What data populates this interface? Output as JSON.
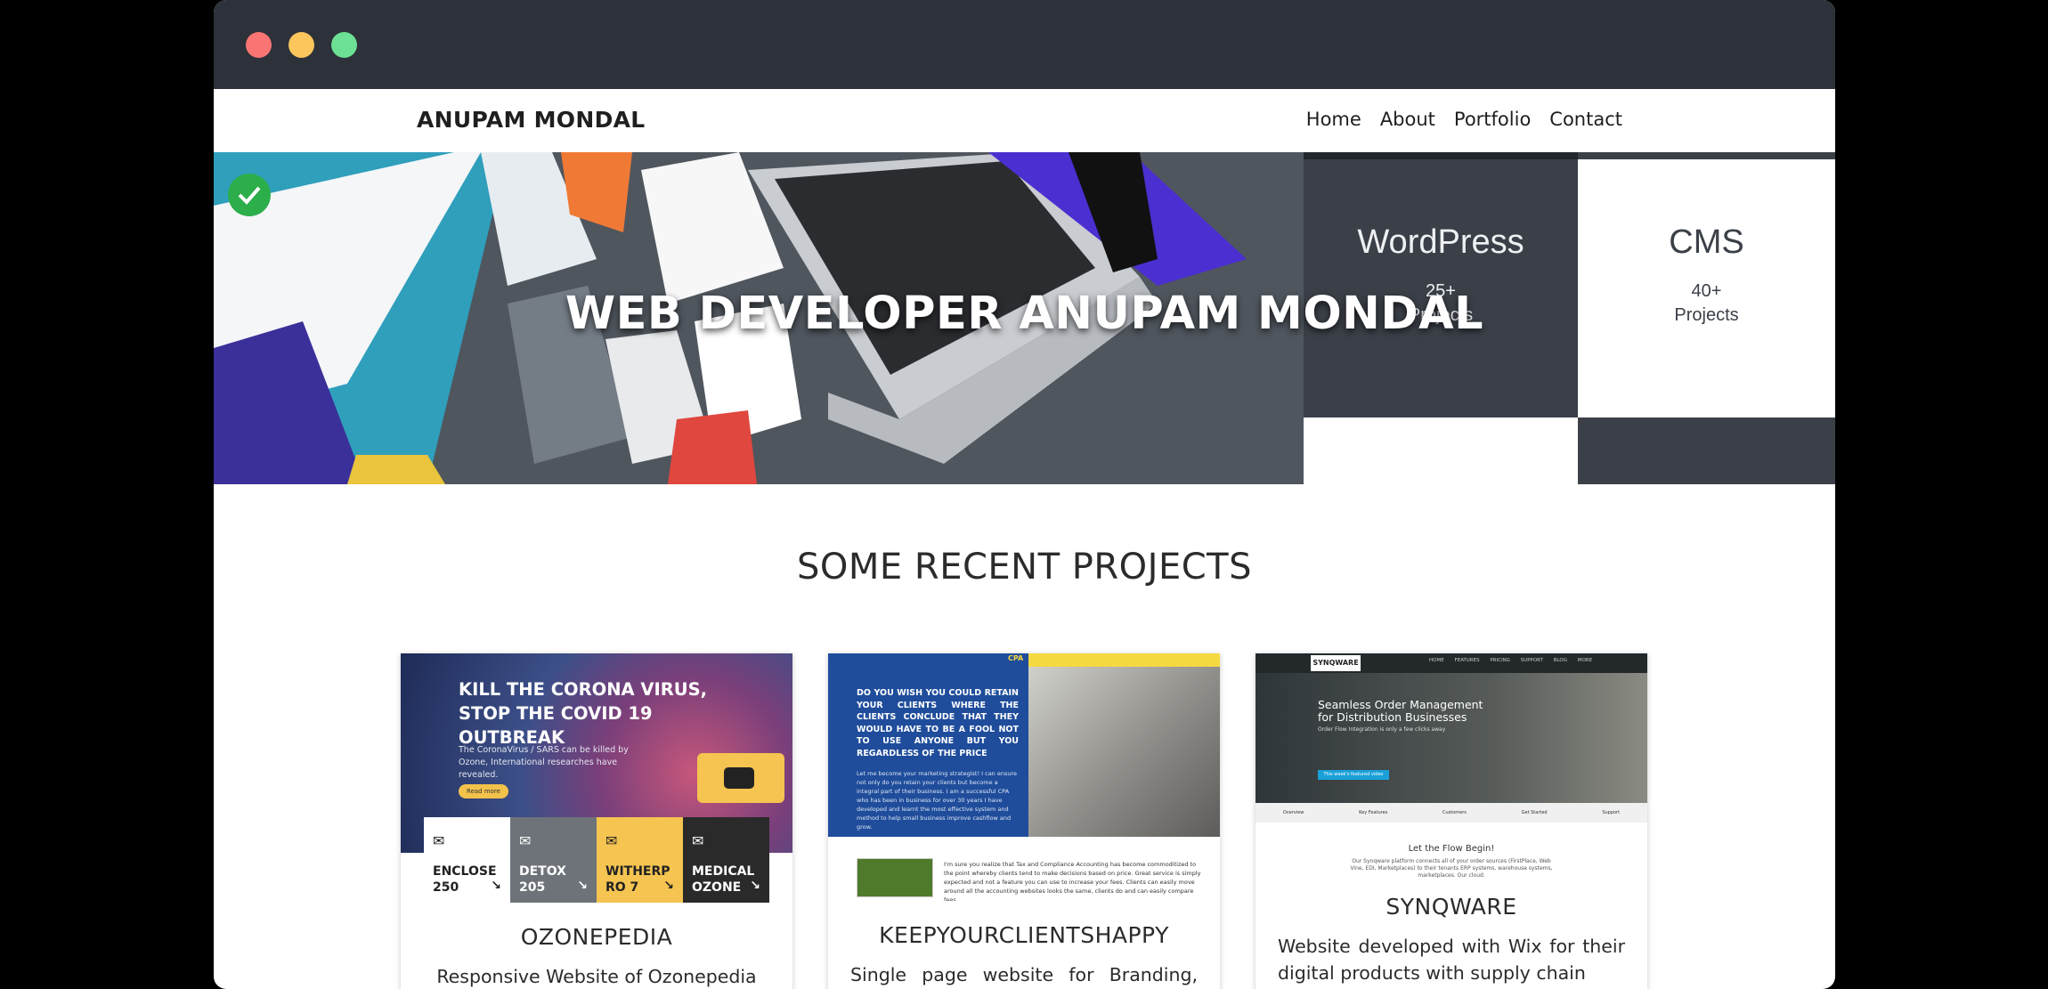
{
  "window": {
    "controls": [
      "close",
      "minimize",
      "maximize"
    ]
  },
  "navbar": {
    "brand": "ANUPAM MONDAL",
    "links": [
      "Home",
      "About",
      "Portfolio",
      "Contact"
    ]
  },
  "hero": {
    "title": "WEB DEVELOPER ANUPAM MONDAL",
    "tiles": [
      {
        "title": "WordPress",
        "count": "25+",
        "unit": "Projects"
      },
      {
        "title": "CMS",
        "count": "40+",
        "unit": "Projects"
      }
    ]
  },
  "projects": {
    "heading": "SOME RECENT PROJECTS",
    "cards": [
      {
        "title": "OZONEPEDIA",
        "desc": "Responsive Website of Ozonepedia with",
        "thumb": {
          "headline": "KILL THE CORONA VIRUS, STOP THE COVID 19 OUTBREAK",
          "sub": "The CoronaVirus / SARS can be killed by Ozone, International researches have revealed.",
          "button": "Read more",
          "tiles": [
            {
              "label": "ENCLOSE 250",
              "bg": "#ffffff",
              "fg": "#222222"
            },
            {
              "label": "DETOX 205",
              "bg": "#6e737a",
              "fg": "#ffffff"
            },
            {
              "label": "WITHERPRO 7",
              "bg": "#f5c451",
              "fg": "#222222"
            },
            {
              "label": "MEDICAL OZONE",
              "bg": "#2a2a2a",
              "fg": "#ffffff"
            }
          ]
        }
      },
      {
        "title": "KEEPYOURCLIENTSHAPPY",
        "desc": "Single page website for Branding,",
        "thumb": {
          "badge": "CPA",
          "headline": "DO YOU WISH YOU COULD RETAIN YOUR CLIENTS WHERE THE CLIENTS CONCLUDE THAT THEY WOULD HAVE TO BE A FOOL NOT TO USE ANYONE BUT YOU REGARDLESS OF THE PRICE",
          "body": "Let me become your marketing strategist! I can ensure not only do you retain your clients but become a integral part of their business. I am a successful CPA who has been in business for over 30 years I have developed and learnt the most effective system and method to help small business improve cashflow and grow.",
          "body2": "I'm sure you realize that Tax and Compliance Accounting has become commoditized to the point whereby clients tend to make decisions based on price. Great service is simply expected and not a feature you can use to increase your fees. Clients can easily move around all the accounting websites looks the same, clients do and can easily compare fees."
        }
      },
      {
        "title": "SYNQWARE",
        "desc": "Website developed with Wix for their digital products with supply chain",
        "thumb": {
          "logo": "SYNQWARE",
          "menu": [
            "HOME",
            "FEATURES",
            "PRICING",
            "SUPPORT",
            "BLOG",
            "MORE"
          ],
          "headline": "Seamless Order Management for Distribution Businesses",
          "sub": "Order Flow Integration is only a few clicks away",
          "button": "This week's featured video",
          "tabs": [
            "Overview",
            "Key Features",
            "Customers",
            "Get Started",
            "Support"
          ],
          "flow_title": "Let the Flow Begin!",
          "flow_text": "Our Synqware platform connects all of your order sources (FirstPlace, Web Vine, EDI, Marketplaces) to their tenants ERP systems, warehouse systems, marketplaces. Our cloud."
        }
      }
    ]
  },
  "colors": {
    "titlebar": "#2d3139",
    "close": "#fb7474",
    "minimize": "#fcc65c",
    "maximize": "#6ce195",
    "text": "#2b2b2b"
  }
}
